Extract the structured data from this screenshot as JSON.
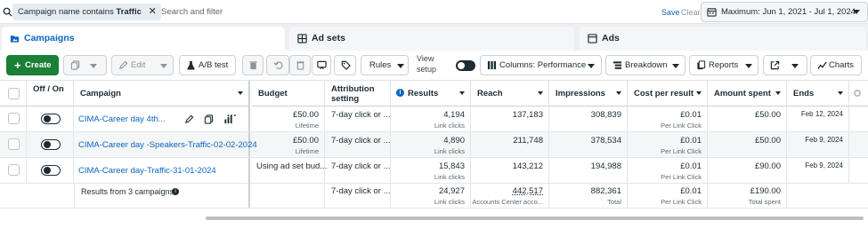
{
  "search": {
    "chip_prefix": "Campaign name contains",
    "chip_value": "Traffic",
    "placeholder": "Search and filter",
    "save": "Save",
    "clear": "Clear",
    "date_range": "Maximum: Jun 1, 2021 - Jul 1, 2024"
  },
  "tabs": [
    {
      "label": "Campaigns",
      "icon": "folder-icon",
      "active": true
    },
    {
      "label": "Ad sets",
      "icon": "grid-icon",
      "active": false
    },
    {
      "label": "Ads",
      "icon": "ad-icon",
      "active": false
    }
  ],
  "toolbar": {
    "create": "Create",
    "edit": "Edit",
    "ab_test": "A/B test",
    "rules": "Rules",
    "view_setup": "View setup",
    "columns": "Columns: Performance",
    "breakdown": "Breakdown",
    "reports": "Reports",
    "charts": "Charts"
  },
  "columns": {
    "off_on": "Off / On",
    "campaign": "Campaign",
    "budget": "Budget",
    "attribution": "Attribution setting",
    "results": "Results",
    "reach": "Reach",
    "impressions": "Impressions",
    "cost_per_result": "Cost per result",
    "amount_spent": "Amount spent",
    "ends": "Ends"
  },
  "rows": [
    {
      "campaign": "CIMA-Career day 4th...",
      "on": false,
      "budget": "£50.00",
      "budget_sub": "Lifetime",
      "attribution": "7-day click or ...",
      "results": "4,194",
      "results_sub": "Link clicks",
      "reach": "137,183",
      "impressions": "308,839",
      "cpr": "£0.01",
      "cpr_sub": "Per Link Click",
      "spent": "£50.00",
      "ends": "Feb 12, 2024"
    },
    {
      "campaign": "CIMA-Career day -Speakers-Traffic-02-02-2024",
      "on": false,
      "budget": "£50.00",
      "budget_sub": "Lifetime",
      "attribution": "7-day click or ...",
      "results": "4,890",
      "results_sub": "Link clicks",
      "reach": "211,748",
      "impressions": "378,534",
      "cpr": "£0.01",
      "cpr_sub": "Per Link Click",
      "spent": "£50.00",
      "ends": "Feb 9, 2024"
    },
    {
      "campaign": "CIMA-Career day-Traffic-31-01-2024",
      "on": false,
      "budget": "Using ad set bud...",
      "budget_sub": "",
      "attribution": "7-day click or ...",
      "results": "15,843",
      "results_sub": "Link clicks",
      "reach": "143,212",
      "impressions": "194,988",
      "cpr": "£0.01",
      "cpr_sub": "Per Link Click",
      "spent": "£90.00",
      "ends": "Feb 9, 2024"
    }
  ],
  "summary": {
    "label": "Results from 3 campaigns",
    "attribution": "7-day click or ...",
    "results": "24,927",
    "results_sub": "Link clicks",
    "reach": "442,517",
    "reach_sub": "Accounts Center acco...",
    "impressions": "882,361",
    "impressions_sub": "Total",
    "cpr": "£0.01",
    "cpr_sub": "Per Link Click",
    "spent": "£190.00",
    "spent_sub": "Total spent"
  },
  "colors": {
    "accent": "#0a66c2",
    "create_green": "#1a7f37"
  }
}
